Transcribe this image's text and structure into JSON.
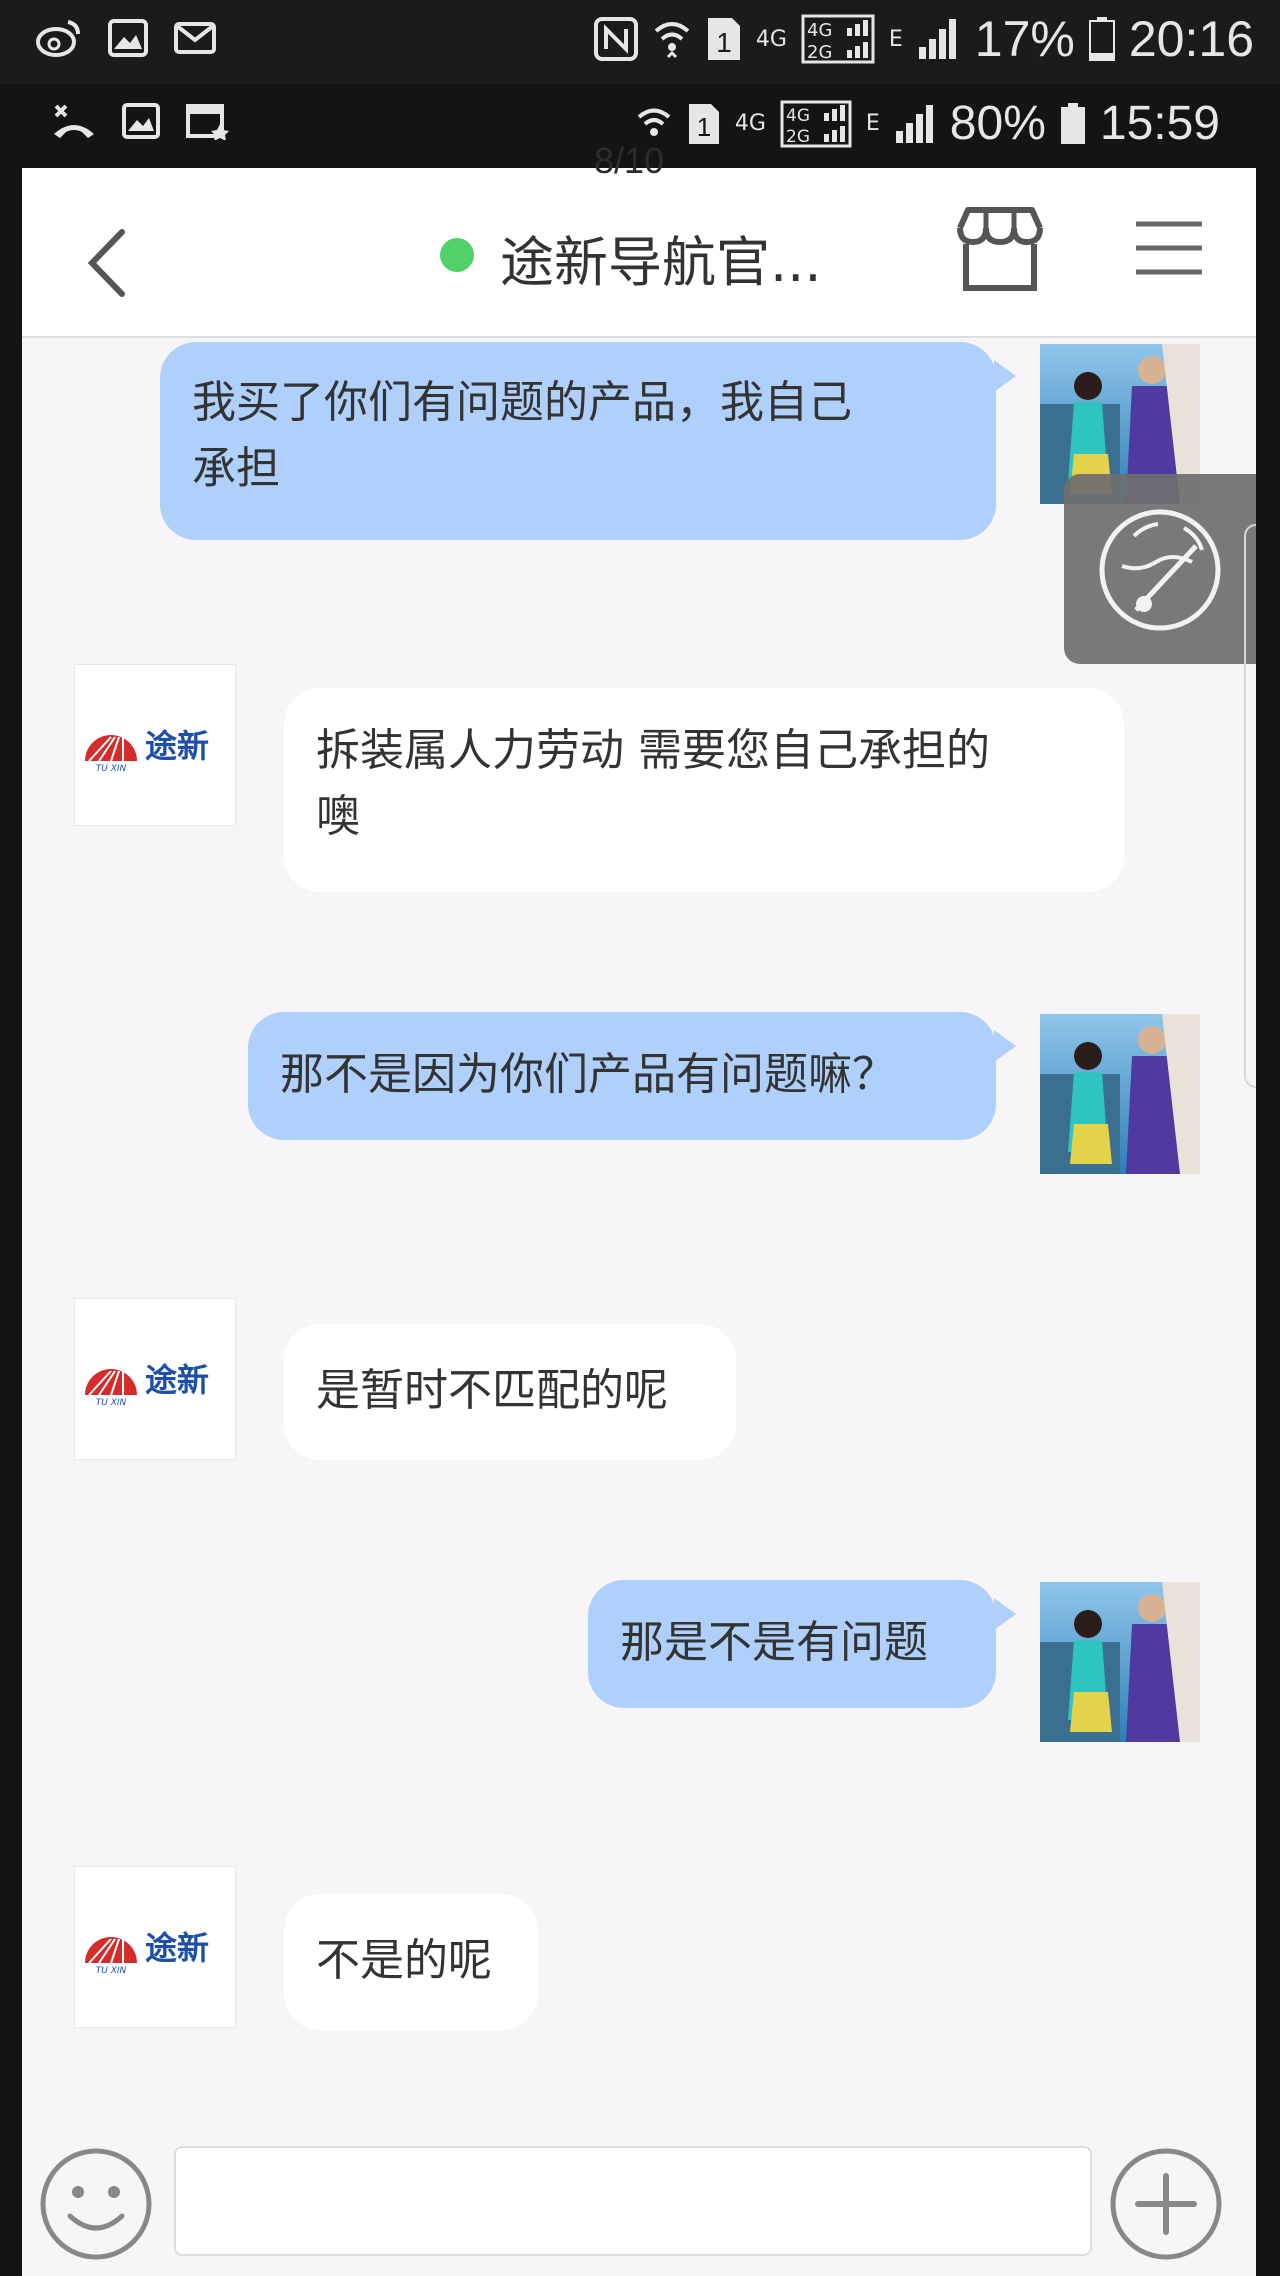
{
  "outer_status_bar": {
    "battery": "17%",
    "time": "20:16",
    "network": "4G",
    "sim": "1",
    "signal_extra": "E"
  },
  "inner_status_bar": {
    "battery": "80%",
    "time": "15:59",
    "network": "4G",
    "sim": "1",
    "signal_extra": "E"
  },
  "page_counter": "8/10",
  "header": {
    "title": "途新导航官...",
    "status_color": "#52d16a"
  },
  "messages": [
    {
      "sender": "me",
      "text_line1": "我买了你们有问题的产品，我自己",
      "text_line2": "承担"
    },
    {
      "sender": "them",
      "text_line1": "拆装属人力劳动 需要您自己承担的",
      "text_line2": "噢"
    },
    {
      "sender": "me",
      "text": "那不是因为你们产品有问题嘛？"
    },
    {
      "sender": "them",
      "text": "是暂时不匹配的呢"
    },
    {
      "sender": "me",
      "text": "那是不是有问题"
    },
    {
      "sender": "them",
      "text": "不是的呢"
    }
  ],
  "brand": {
    "logo_text": "途新",
    "logo_subtext": "TU XIN",
    "logo_color": "#1e4fa8",
    "logo_accent": "#d62b2b"
  },
  "colors": {
    "my_bubble": "#aed0fb",
    "their_bubble": "#ffffff",
    "background": "#f7f5f8"
  },
  "input": {
    "placeholder": ""
  }
}
